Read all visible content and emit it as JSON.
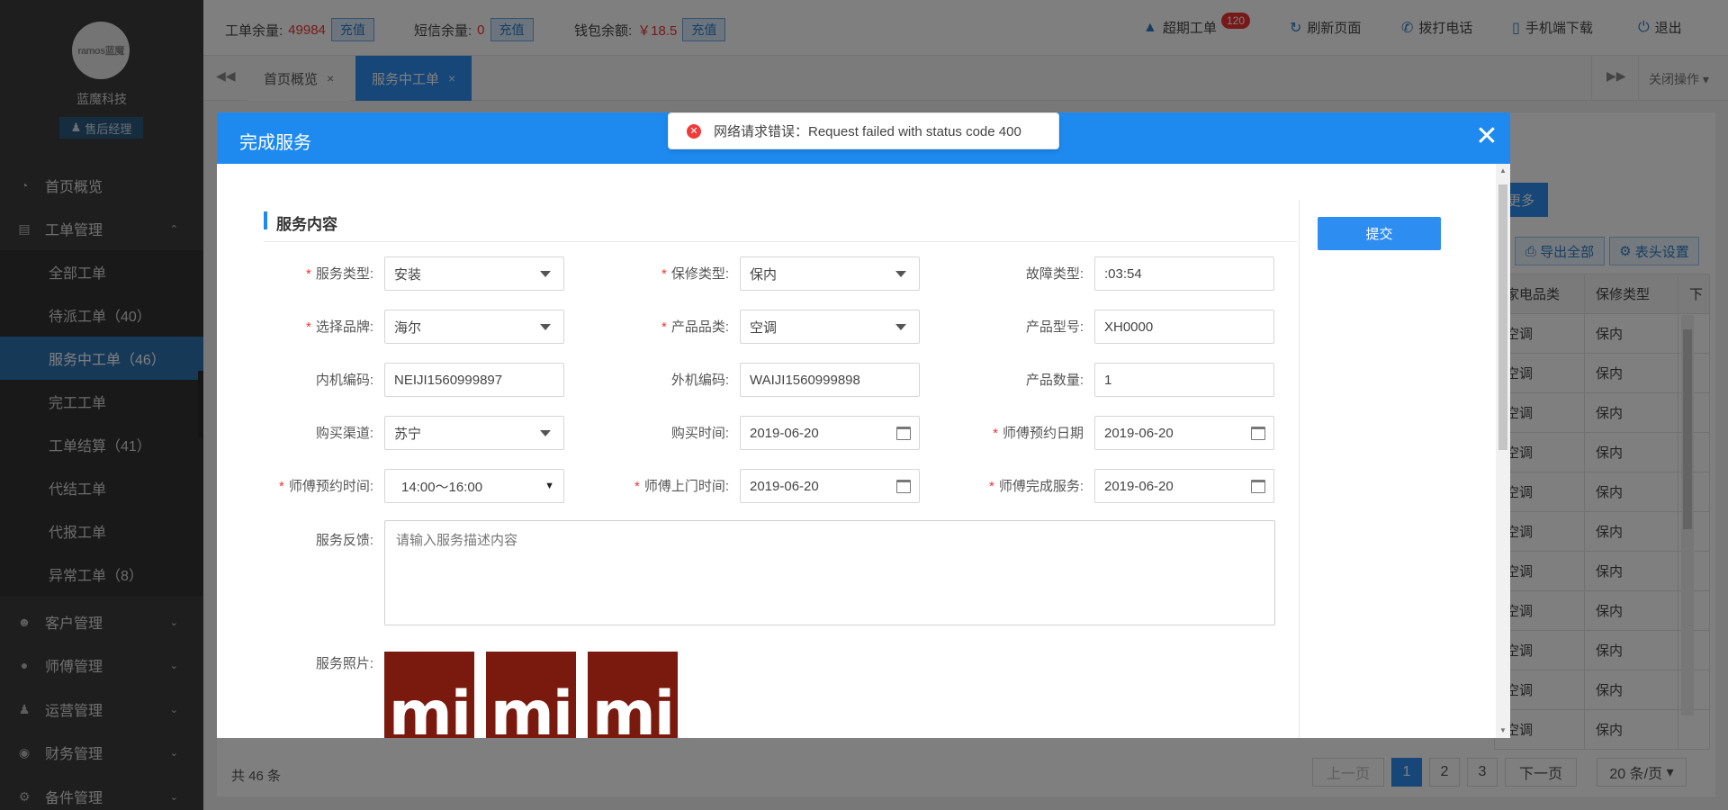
{
  "sidebar": {
    "logo_text": "ramos蓝魔",
    "company": "蓝魔科技",
    "role": "售后经理",
    "menu": [
      {
        "label": "首页概览",
        "icon": "pie-chart-icon"
      },
      {
        "label": "工单管理",
        "icon": "clipboard-icon",
        "expanded": true,
        "children": [
          "全部工单",
          "待派工单（40）",
          "服务中工单（46）",
          "完工工单",
          "工单结算（41）",
          "代结工单",
          "代报工单",
          "异常工单（8）"
        ]
      },
      {
        "label": "客户管理",
        "icon": "users-icon"
      },
      {
        "label": "师傅管理",
        "icon": "user-icon"
      },
      {
        "label": "运营管理",
        "icon": "user-group-icon"
      },
      {
        "label": "财务管理",
        "icon": "finance-icon"
      },
      {
        "label": "备件管理",
        "icon": "gear-icon"
      }
    ],
    "active_child": "服务中工单（46）"
  },
  "topbar": {
    "work_order_label": "工单余量:",
    "work_order_value": "49984",
    "sms_label": "短信余量:",
    "sms_value": "0",
    "wallet_label": "钱包余额:",
    "wallet_value": "￥18.5",
    "recharge": "充值",
    "overdue_label": "超期工单",
    "overdue_count": "120",
    "refresh": "刷新页面",
    "call": "拨打电话",
    "mobile_download": "手机端下载",
    "logout": "退出"
  },
  "tabs": {
    "items": [
      "首页概览",
      "服务中工单"
    ],
    "active": "服务中工单",
    "close_ops": "关闭操作"
  },
  "background_page": {
    "more_button": "更多",
    "export_all": "导出全部",
    "header_settings": "表头设置",
    "columns": [
      "家电品类",
      "保修类型",
      "下"
    ],
    "rows": [
      [
        "空调",
        "保内"
      ],
      [
        "空调",
        "保内"
      ],
      [
        "空调",
        "保内"
      ],
      [
        "空调",
        "保内"
      ],
      [
        "空调",
        "保内"
      ],
      [
        "空调",
        "保内"
      ],
      [
        "空调",
        "保内"
      ],
      [
        "空调",
        "保内"
      ],
      [
        "空调",
        "保内"
      ],
      [
        "空调",
        "保内"
      ],
      [
        "空调",
        "保内"
      ]
    ],
    "total": "共 46 条",
    "pagination": {
      "prev": "上一页",
      "pages": [
        "1",
        "2",
        "3"
      ],
      "current": "1",
      "next": "下一页",
      "page_size": "20 条/页"
    }
  },
  "modal": {
    "title": "完成服务",
    "section_title": "服务内容",
    "submit": "提交",
    "fields": {
      "service_type": {
        "label": "服务类型:",
        "value": "安装",
        "required": true
      },
      "warranty_type": {
        "label": "保修类型:",
        "value": "保内",
        "required": true
      },
      "fault_type": {
        "label": "故障类型:",
        "value": ":03:54",
        "required": false
      },
      "brand": {
        "label": "选择品牌:",
        "value": "海尔",
        "required": true
      },
      "category": {
        "label": "产品品类:",
        "value": "空调",
        "required": true
      },
      "model": {
        "label": "产品型号:",
        "value": "XH0000",
        "required": false
      },
      "indoor_code": {
        "label": "内机编码:",
        "value": "NEIJI1560999897",
        "required": false
      },
      "outdoor_code": {
        "label": "外机编码:",
        "value": "WAIJI1560999898",
        "required": false
      },
      "quantity": {
        "label": "产品数量:",
        "value": "1",
        "required": false
      },
      "channel": {
        "label": "购买渠道:",
        "value": "苏宁",
        "required": false
      },
      "purchase_date": {
        "label": "购买时间:",
        "value": "2019-06-20",
        "required": false
      },
      "appoint_date": {
        "label": "师傅预约日期",
        "value": "2019-06-20",
        "required": true
      },
      "appoint_time": {
        "label": "师傅预约时间:",
        "value": "14:00～16:00",
        "required": true
      },
      "visit_time": {
        "label": "师傅上门时间:",
        "value": "2019-06-20",
        "required": true
      },
      "finish_time": {
        "label": "师傅完成服务:",
        "value": "2019-06-20",
        "required": true
      },
      "feedback": {
        "label": "服务反馈:",
        "placeholder": "请输入服务描述内容"
      },
      "photos": {
        "label": "服务照片:",
        "images": [
          "mi-logo",
          "mi-logo",
          "mi-logo"
        ],
        "mark": "mi"
      }
    }
  },
  "toast": {
    "message": "网络请求错误：Request failed with status code 400",
    "icon": "error-icon",
    "color": "#ee3b3b"
  },
  "colors": {
    "primary": "#1e8af0",
    "sidebar": "#3c3c3c",
    "active_nav": "#2e73b0",
    "photo_bg": "#7a1a0e"
  }
}
